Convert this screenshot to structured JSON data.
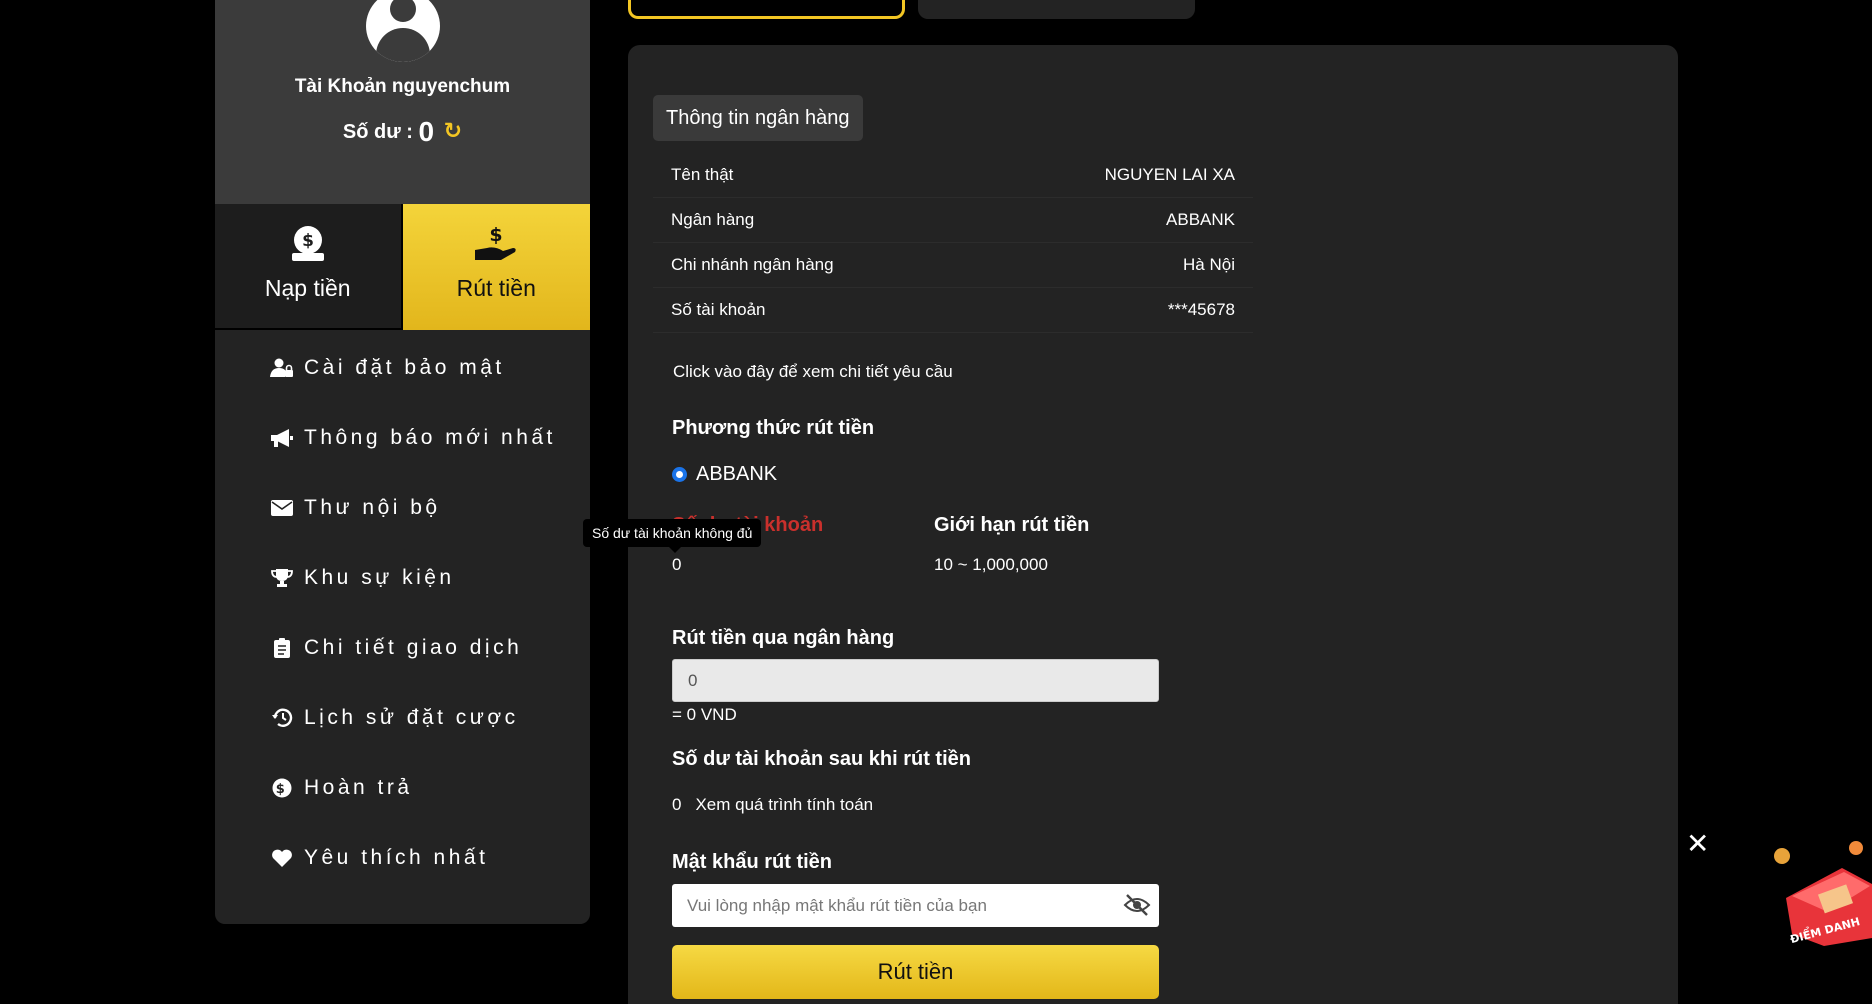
{
  "profile": {
    "account_label": "Tài Khoản nguyenchum",
    "balance_label": "Số dư :",
    "balance_value": "0"
  },
  "tabs": {
    "deposit": "Nạp tiền",
    "withdraw": "Rút tiền"
  },
  "menu": [
    {
      "label": "Cài đặt bảo mật",
      "icon": "user-lock-icon"
    },
    {
      "label": "Thông báo mới nhất",
      "icon": "megaphone-icon"
    },
    {
      "label": "Thư nội bộ",
      "icon": "envelope-icon"
    },
    {
      "label": "Khu sự kiện",
      "icon": "trophy-icon"
    },
    {
      "label": "Chi tiết giao dịch",
      "icon": "clipboard-icon"
    },
    {
      "label": "Lịch sử đặt cược",
      "icon": "history-icon"
    },
    {
      "label": "Hoàn trả",
      "icon": "dollar-circle-icon"
    },
    {
      "label": "Yêu thích nhất",
      "icon": "heart-icon"
    }
  ],
  "bank": {
    "title": "Thông tin ngân hàng",
    "rows": [
      {
        "label": "Tên thật",
        "value": "NGUYEN LAI XA"
      },
      {
        "label": "Ngân hàng",
        "value": "ABBANK"
      },
      {
        "label": "Chi nhánh ngân hàng",
        "value": "Hà Nội"
      },
      {
        "label": "Số tài khoản",
        "value": "***45678"
      }
    ]
  },
  "withdraw": {
    "detail_link": "Click vào đây để xem chi tiết yêu cầu",
    "method_title": "Phương thức rút tiền",
    "method_option": "ABBANK",
    "balance_label": "Số dư tài khoản",
    "limit_label": "Giới hạn rút tiền",
    "balance_value": "0",
    "limit_value": "10 ~ 1,000,000",
    "bank_title": "Rút tiền qua ngân hàng",
    "amount_value": "0",
    "vnd_text": "= 0 VND",
    "after_title": "Số dư tài khoản sau khi rút tiền",
    "after_value": "0",
    "calc_link": "Xem quá trình tính toán",
    "password_title": "Mật khẩu rút tiền",
    "password_placeholder": "Vui lòng nhập mật khẩu rút tiền của bạn",
    "submit_label": "Rút tiền"
  },
  "tooltip": "Số dư tài khoản không đủ",
  "widget": {
    "close": "✕",
    "gift_text": "ĐIỂM DANH"
  },
  "colors": {
    "accent": "#f3c623",
    "panel": "#232323",
    "error": "#c9302c"
  }
}
